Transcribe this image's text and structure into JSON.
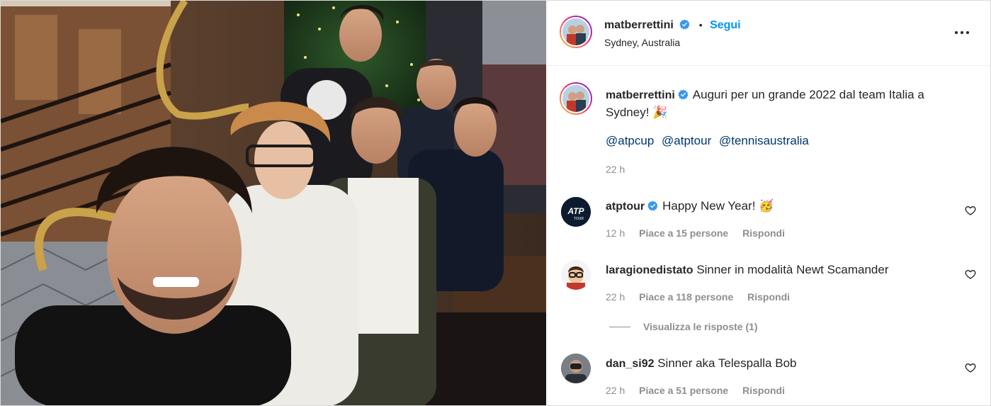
{
  "post": {
    "username": "matberrettini",
    "verified": true,
    "separator": "•",
    "follow_label": "Segui",
    "location": "Sydney, Australia"
  },
  "caption": {
    "username": "matberrettini",
    "text": "Auguri per un grande 2022 dal team Italia a Sydney! 🎉",
    "mentions": [
      "@atpcup",
      "@atptour",
      "@tennisaustralia"
    ],
    "age": "22 h"
  },
  "comments": [
    {
      "username": "atptour",
      "verified": true,
      "text": "Happy New Year! 🥳",
      "time": "12 h",
      "likes": "Piace a 15 persone",
      "reply": "Rispondi"
    },
    {
      "username": "laragionedistato",
      "verified": false,
      "text": "Sinner in modalità Newt Scamander",
      "time": "22 h",
      "likes": "Piace a 118 persone",
      "reply": "Rispondi"
    },
    {
      "username": "dan_si92",
      "verified": false,
      "text": "Sinner aka Telespalla Bob",
      "time": "22 h",
      "likes": "Piace a 51 persone",
      "reply": "Rispondi"
    }
  ],
  "view_replies": "Visualizza le risposte (1)",
  "colors": {
    "accent": "#0095f6",
    "verified": "#3897f0",
    "mention": "#00376b",
    "meta": "#8e8e8e"
  },
  "icons": [
    "verified-badge-icon",
    "more-options-icon",
    "heart-icon"
  ]
}
